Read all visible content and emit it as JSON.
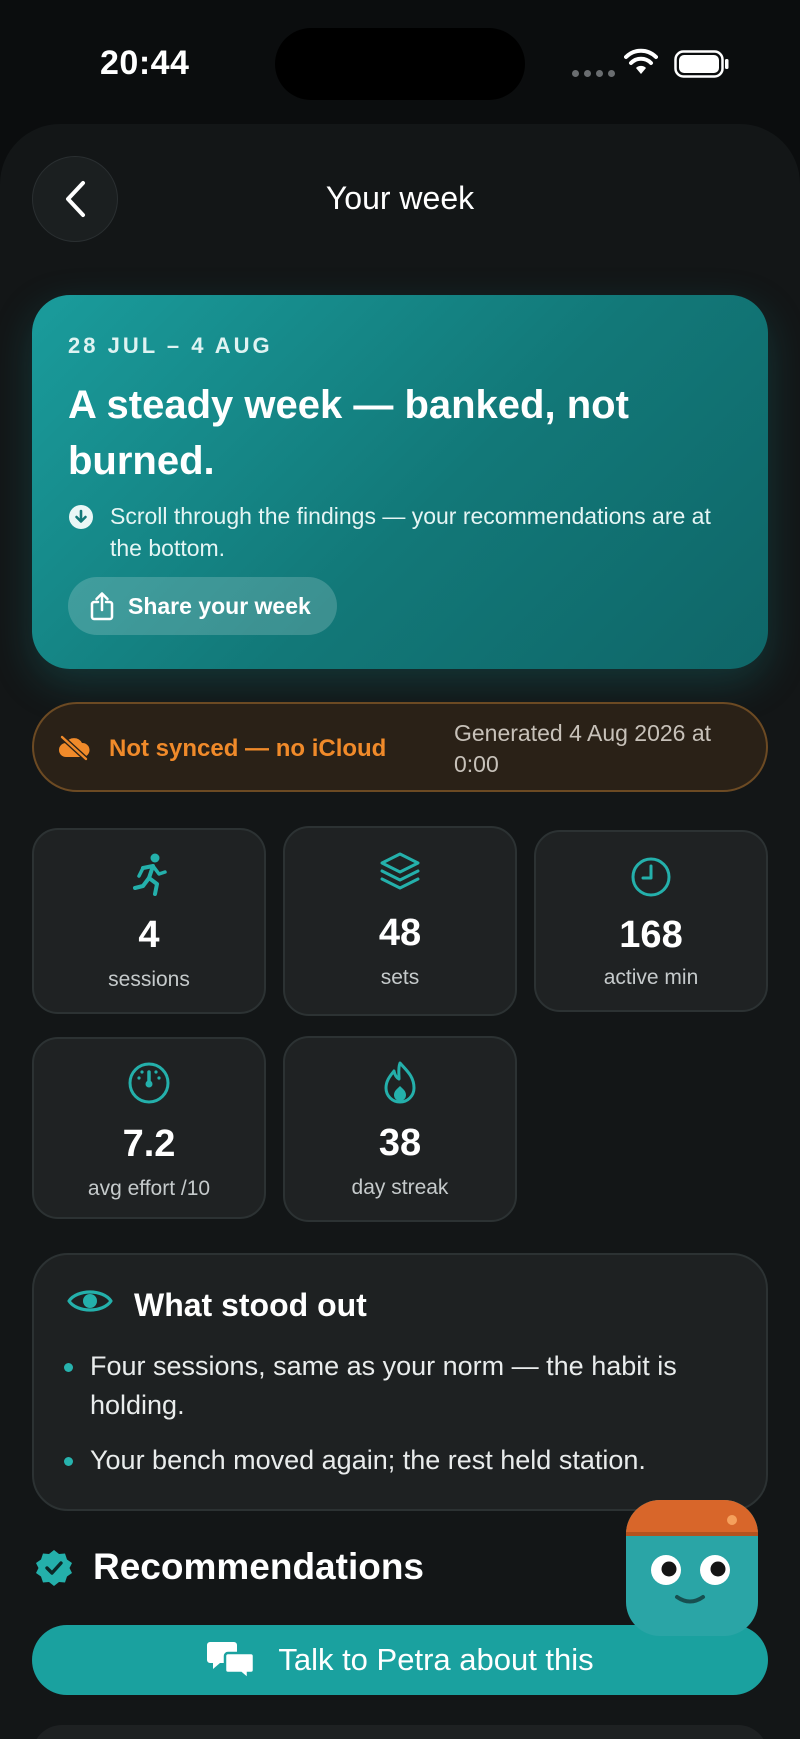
{
  "status_bar": {
    "time": "20:44"
  },
  "nav": {
    "title": "Your week"
  },
  "hero": {
    "date_range": "28 JUL – 4 AUG",
    "headline": "A steady week — banked, not burned.",
    "hint": "Scroll through the findings — your recommendations are at the bottom.",
    "share_label": "Share your week"
  },
  "sync": {
    "status": "Not synced — no iCloud",
    "generated": "Generated 4 Aug 2026 at 0:00"
  },
  "stats": [
    {
      "icon": "running-figure-icon",
      "value": "4",
      "label": "sessions"
    },
    {
      "icon": "layers-icon",
      "value": "48",
      "label": "sets"
    },
    {
      "icon": "clock-icon",
      "value": "168",
      "label": "active min"
    },
    {
      "icon": "gauge-icon",
      "value": "7.2",
      "label": "avg effort /10"
    },
    {
      "icon": "flame-icon",
      "value": "38",
      "label": "day streak"
    }
  ],
  "standout": {
    "title": "What stood out",
    "items": [
      "Four sessions, same as your norm — the habit is holding.",
      "Your bench moved again; the rest held station."
    ]
  },
  "recommendations": {
    "title": "Recommendations",
    "talk_label": "Talk to Petra about this"
  },
  "colors": {
    "accent": "#1aa19f",
    "hero": "#127878",
    "warning": "#f08a2a",
    "background": "#131617"
  }
}
